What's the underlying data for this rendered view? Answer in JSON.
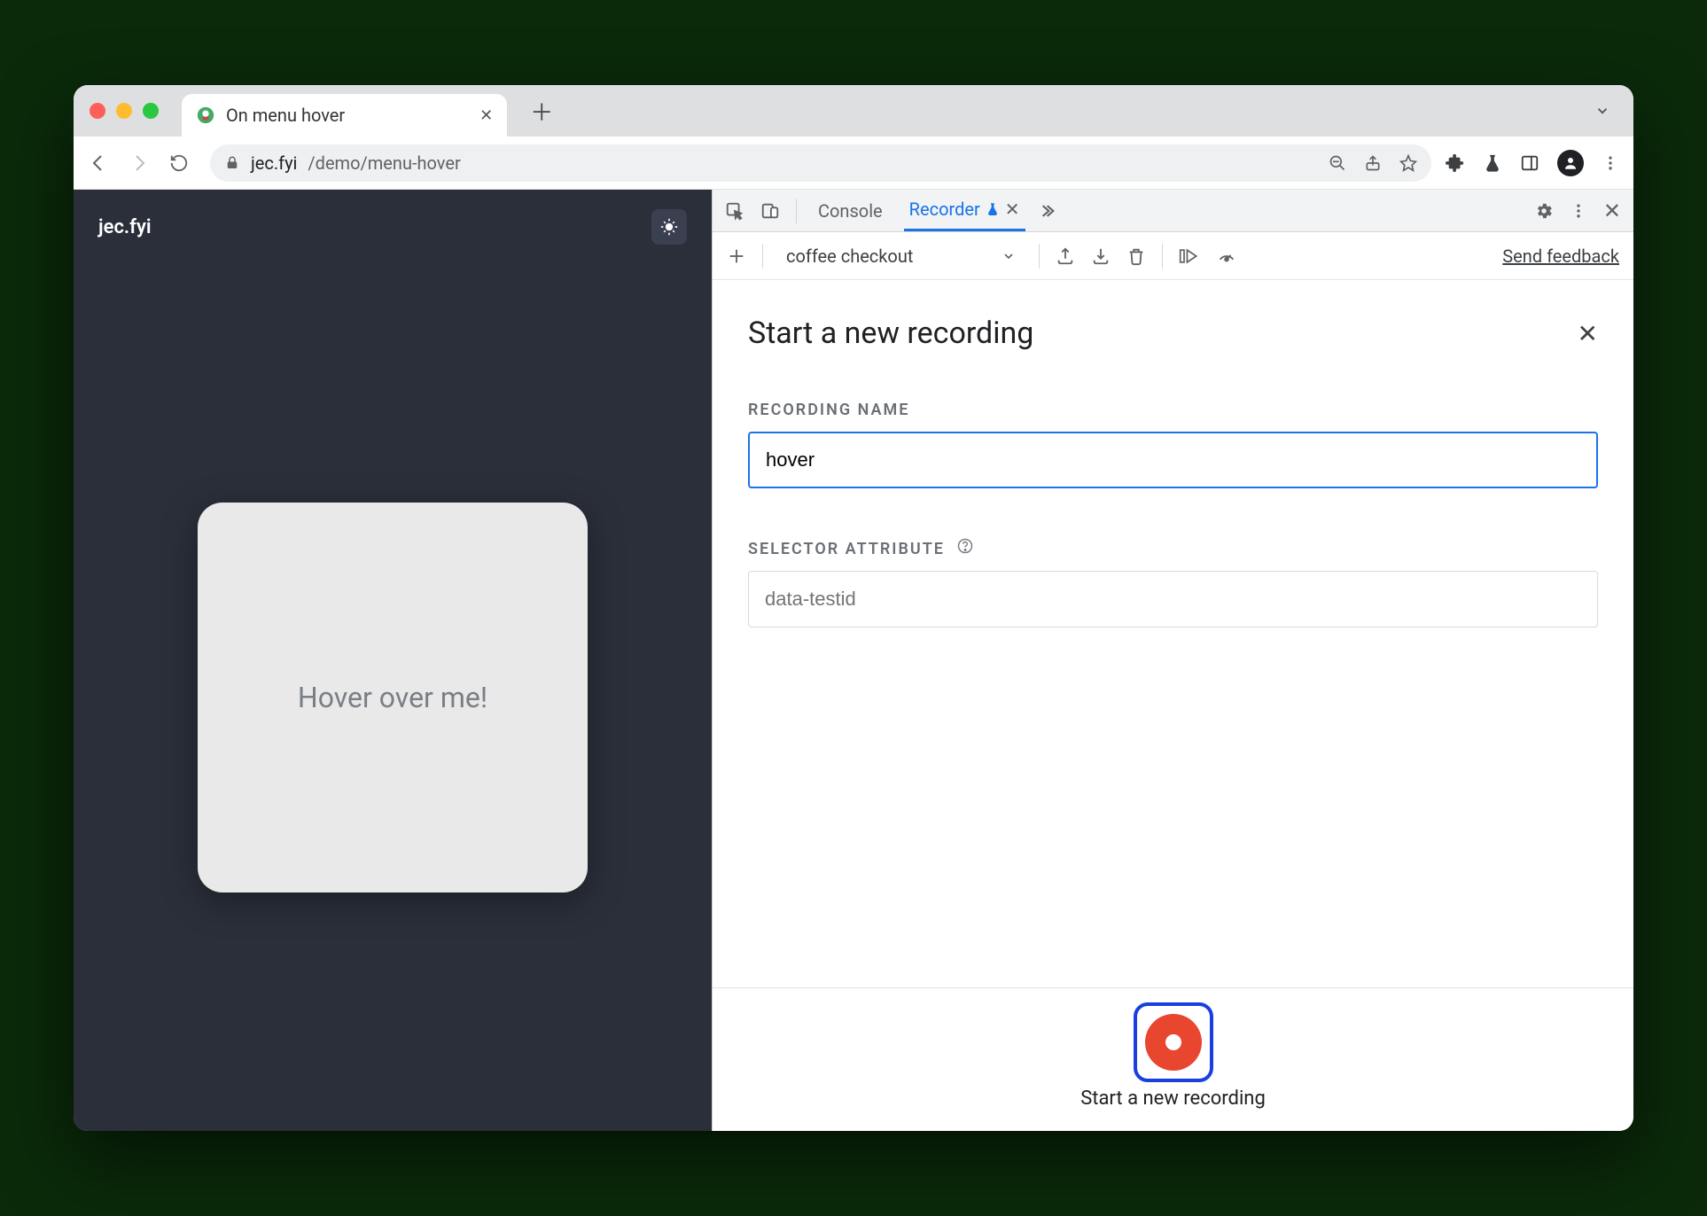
{
  "browser": {
    "tab_title": "On menu hover",
    "url_host": "jec.fyi",
    "url_path": "/demo/menu-hover"
  },
  "page": {
    "site_name": "jec.fyi",
    "card_text": "Hover over me!"
  },
  "devtools": {
    "tabs": {
      "console": "Console",
      "recorder": "Recorder"
    },
    "toolbar": {
      "recording_select": "coffee checkout",
      "feedback_link": "Send feedback"
    },
    "panel": {
      "title": "Start a new recording",
      "recording_name_label": "RECORDING NAME",
      "recording_name_value": "hover",
      "selector_label": "SELECTOR ATTRIBUTE",
      "selector_placeholder": "data-testid",
      "record_button_label": "Start a new recording"
    }
  }
}
